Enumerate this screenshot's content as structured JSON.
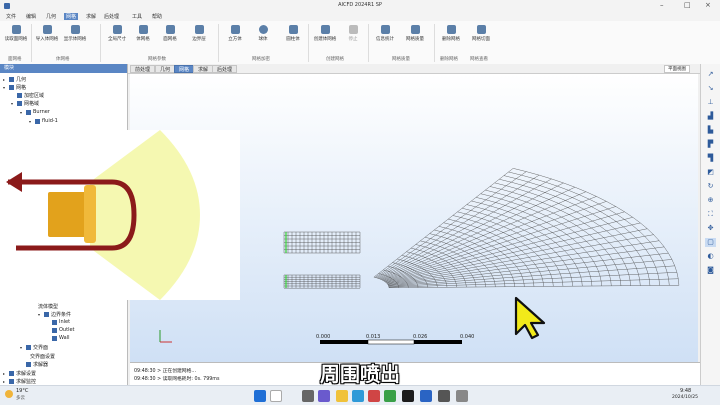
{
  "window": {
    "title": "AICFD 2024R1 SP"
  },
  "menu": [
    "文件",
    "编辑",
    "几何",
    "网格",
    "求解",
    "后处理",
    "工具",
    "帮助"
  ],
  "ribbon": {
    "groups": [
      {
        "label": "面网格"
      },
      {
        "label": "体网格"
      },
      {
        "label": "网格参数"
      },
      {
        "label": "网格加密"
      },
      {
        "label": "创建网格"
      },
      {
        "label": "网格质量"
      },
      {
        "label": "删除网格"
      },
      {
        "label": "网格查看"
      }
    ],
    "tools": [
      {
        "label": "读取面网格",
        "icon": "surface-mesh-icon"
      },
      {
        "label": "导入体网格",
        "icon": "import-mesh-icon"
      },
      {
        "label": "显示体网格",
        "icon": "show-mesh-icon"
      },
      {
        "label": "全局尺寸",
        "icon": "global-size-icon"
      },
      {
        "label": "体网格",
        "icon": "volume-mesh-icon"
      },
      {
        "label": "面网格",
        "icon": "face-mesh-icon"
      },
      {
        "label": "边界层",
        "icon": "boundary-layer-icon"
      },
      {
        "label": "立方体",
        "icon": "cube-icon"
      },
      {
        "label": "球体",
        "icon": "sphere-icon"
      },
      {
        "label": "圆柱体",
        "icon": "cylinder-icon"
      },
      {
        "label": "创建体网格",
        "icon": "create-mesh-icon"
      },
      {
        "label": "停止",
        "icon": "stop-icon"
      },
      {
        "label": "信息统计",
        "icon": "stats-icon"
      },
      {
        "label": "网格质量",
        "icon": "quality-icon"
      },
      {
        "label": "删除网格",
        "icon": "delete-mesh-icon"
      },
      {
        "label": "网格切面",
        "icon": "section-icon"
      }
    ]
  },
  "left_panel": {
    "header": "模块",
    "tree": [
      {
        "label": "几何",
        "indent": 0
      },
      {
        "label": "网格",
        "indent": 0
      },
      {
        "label": "加密区域",
        "indent": 1
      },
      {
        "label": "网格域",
        "indent": 1
      },
      {
        "label": "Burner",
        "indent": 2
      },
      {
        "label": "fluid-1",
        "indent": 3
      },
      {
        "label": "流体模型",
        "indent": 3
      },
      {
        "label": "边界条件",
        "indent": 3
      },
      {
        "label": "Inlet",
        "indent": 4
      },
      {
        "label": "Outlet",
        "indent": 4
      },
      {
        "label": "Wall",
        "indent": 4
      },
      {
        "label": "交界面",
        "indent": 1
      },
      {
        "label": "交界面设置",
        "indent": 2
      },
      {
        "label": "求解器",
        "indent": 1
      },
      {
        "label": "求解设置",
        "indent": 0
      },
      {
        "label": "求解监控",
        "indent": 0
      }
    ]
  },
  "view_tabs": [
    "前处理",
    "几何",
    "网格",
    "求解",
    "后处理"
  ],
  "active_view_tab": "网格",
  "view_dropdown": "平面视图",
  "scale": {
    "labels": [
      "0.000",
      "0.013",
      "0.026",
      "0.040"
    ]
  },
  "console": {
    "lines": [
      "09:48:30 > 正在创建网格...",
      "09:48:30 > 读取网格耗时: 0s. 799ms"
    ]
  },
  "subtitle": "周围喷出",
  "taskbar": {
    "weather_temp": "19°C",
    "weather_desc": "多云",
    "time": "9:48",
    "date": "2024/10/25"
  },
  "colors": {
    "accent": "#5a86c4",
    "mesh": "#444444",
    "cone": "#f4f7a8",
    "arrow": "#8b1a1a",
    "nozzle": "#e2a21c"
  }
}
